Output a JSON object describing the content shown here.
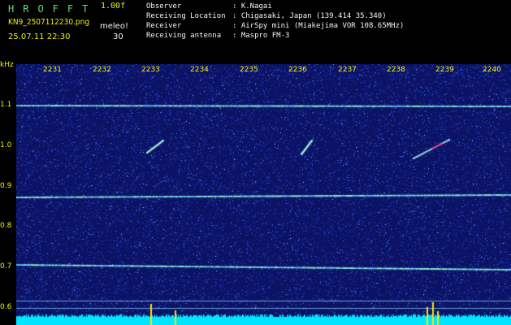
{
  "header": {
    "title": "HROFFT",
    "version": "1.00f",
    "filename": "KN9_2507112230.png",
    "unit_label": "meleo!",
    "datetime": "25.07.11 22:30",
    "gain": "30"
  },
  "info": [
    {
      "label": "Observer",
      "value": ": K.Nagai"
    },
    {
      "label": "Receiving Location",
      "value": ": Chigasaki, Japan (139.414 35.340)"
    },
    {
      "label": "Receiver",
      "value": ": AirSpy mini (Miakejima VOR 108.65MHz)"
    },
    {
      "label": "Receiving antenna",
      "value": ": Maspro FM-3"
    }
  ],
  "y_axis": {
    "unit": "kHz",
    "ticks": [
      "1.1",
      "1.0",
      "0.9",
      "0.8",
      "0.7",
      "0.6"
    ]
  },
  "x_axis": {
    "ticks": [
      "2231",
      "2232",
      "2233",
      "2234",
      "2235",
      "2236",
      "2237",
      "2238",
      "2239",
      "2240"
    ]
  },
  "colors": {
    "background": "#000000",
    "header_green": "#5fe06a",
    "label_yellow": "#f0f000",
    "spectrum_base": "#0d1468",
    "signal_line": "#8ee6c8",
    "noise_floor": "#00e5ff",
    "peak": "#ffe000"
  }
}
